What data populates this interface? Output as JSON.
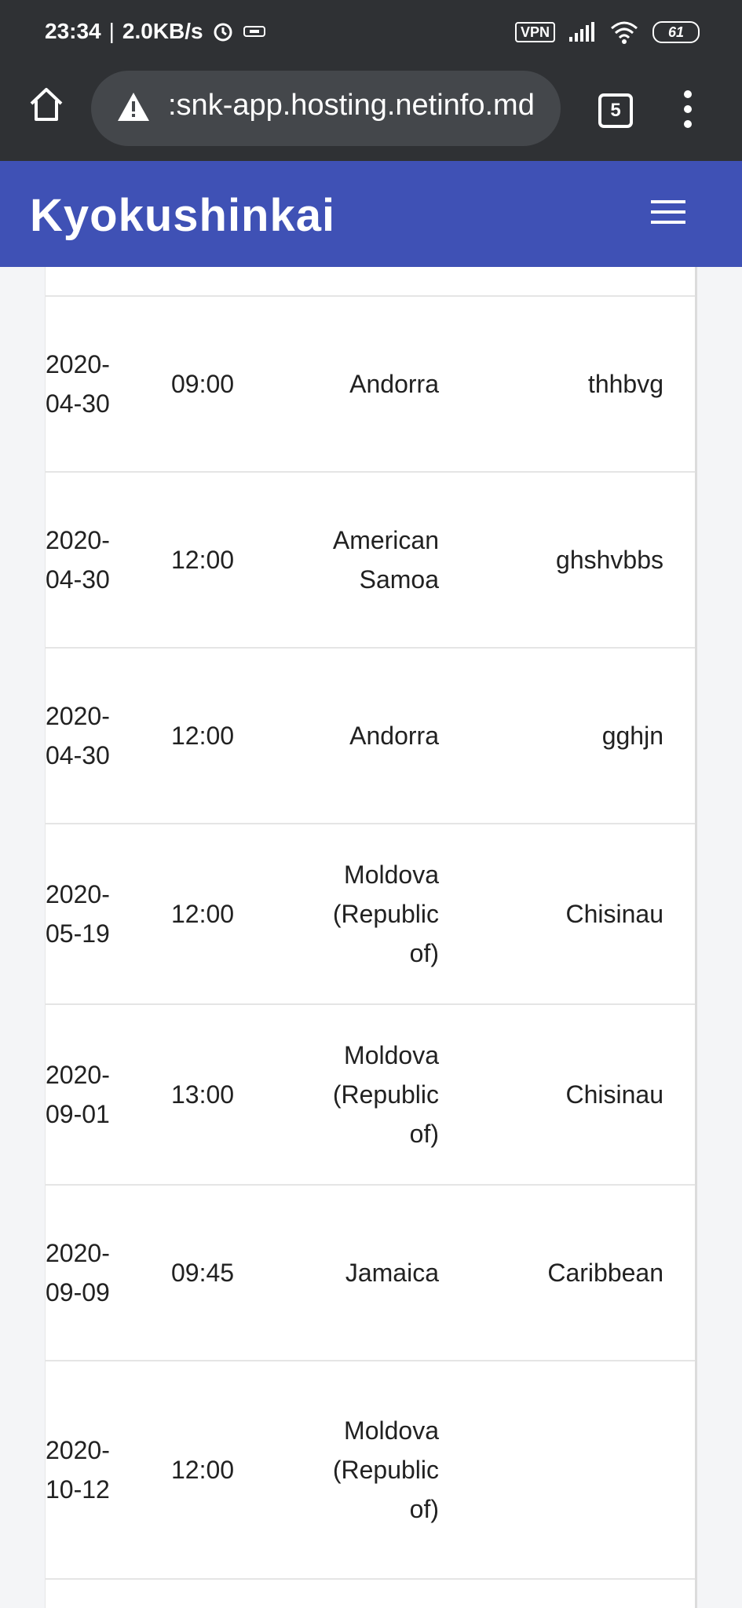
{
  "status_bar": {
    "time": "23:34",
    "speed": "2.0KB/s",
    "vpn": "VPN",
    "battery": "61"
  },
  "browser": {
    "url": ":snk-app.hosting.netinfo.md",
    "tab_count": "5"
  },
  "app": {
    "title": "Kyokushinkai"
  },
  "rows": [
    {
      "date": "2020-\n04-30",
      "time": "09:00",
      "country": "Andorra",
      "city": "thhbvg"
    },
    {
      "date": "2020-\n04-30",
      "time": "12:00",
      "country": "American\nSamoa",
      "city": "ghshvbbs"
    },
    {
      "date": "2020-\n04-30",
      "time": "12:00",
      "country": "Andorra",
      "city": "gghjn"
    },
    {
      "date": "2020-\n05-19",
      "time": "12:00",
      "country": "Moldova\n(Republic\nof)",
      "city": "Chisinau"
    },
    {
      "date": "2020-\n09-01",
      "time": "13:00",
      "country": "Moldova\n(Republic\nof)",
      "city": "Chisinau"
    },
    {
      "date": "2020-\n09-09",
      "time": "09:45",
      "country": "Jamaica",
      "city": "Caribbean"
    },
    {
      "date": "2020-\n10-12",
      "time": "12:00",
      "country": "Moldova\n(Republic\nof)",
      "city": ""
    }
  ]
}
